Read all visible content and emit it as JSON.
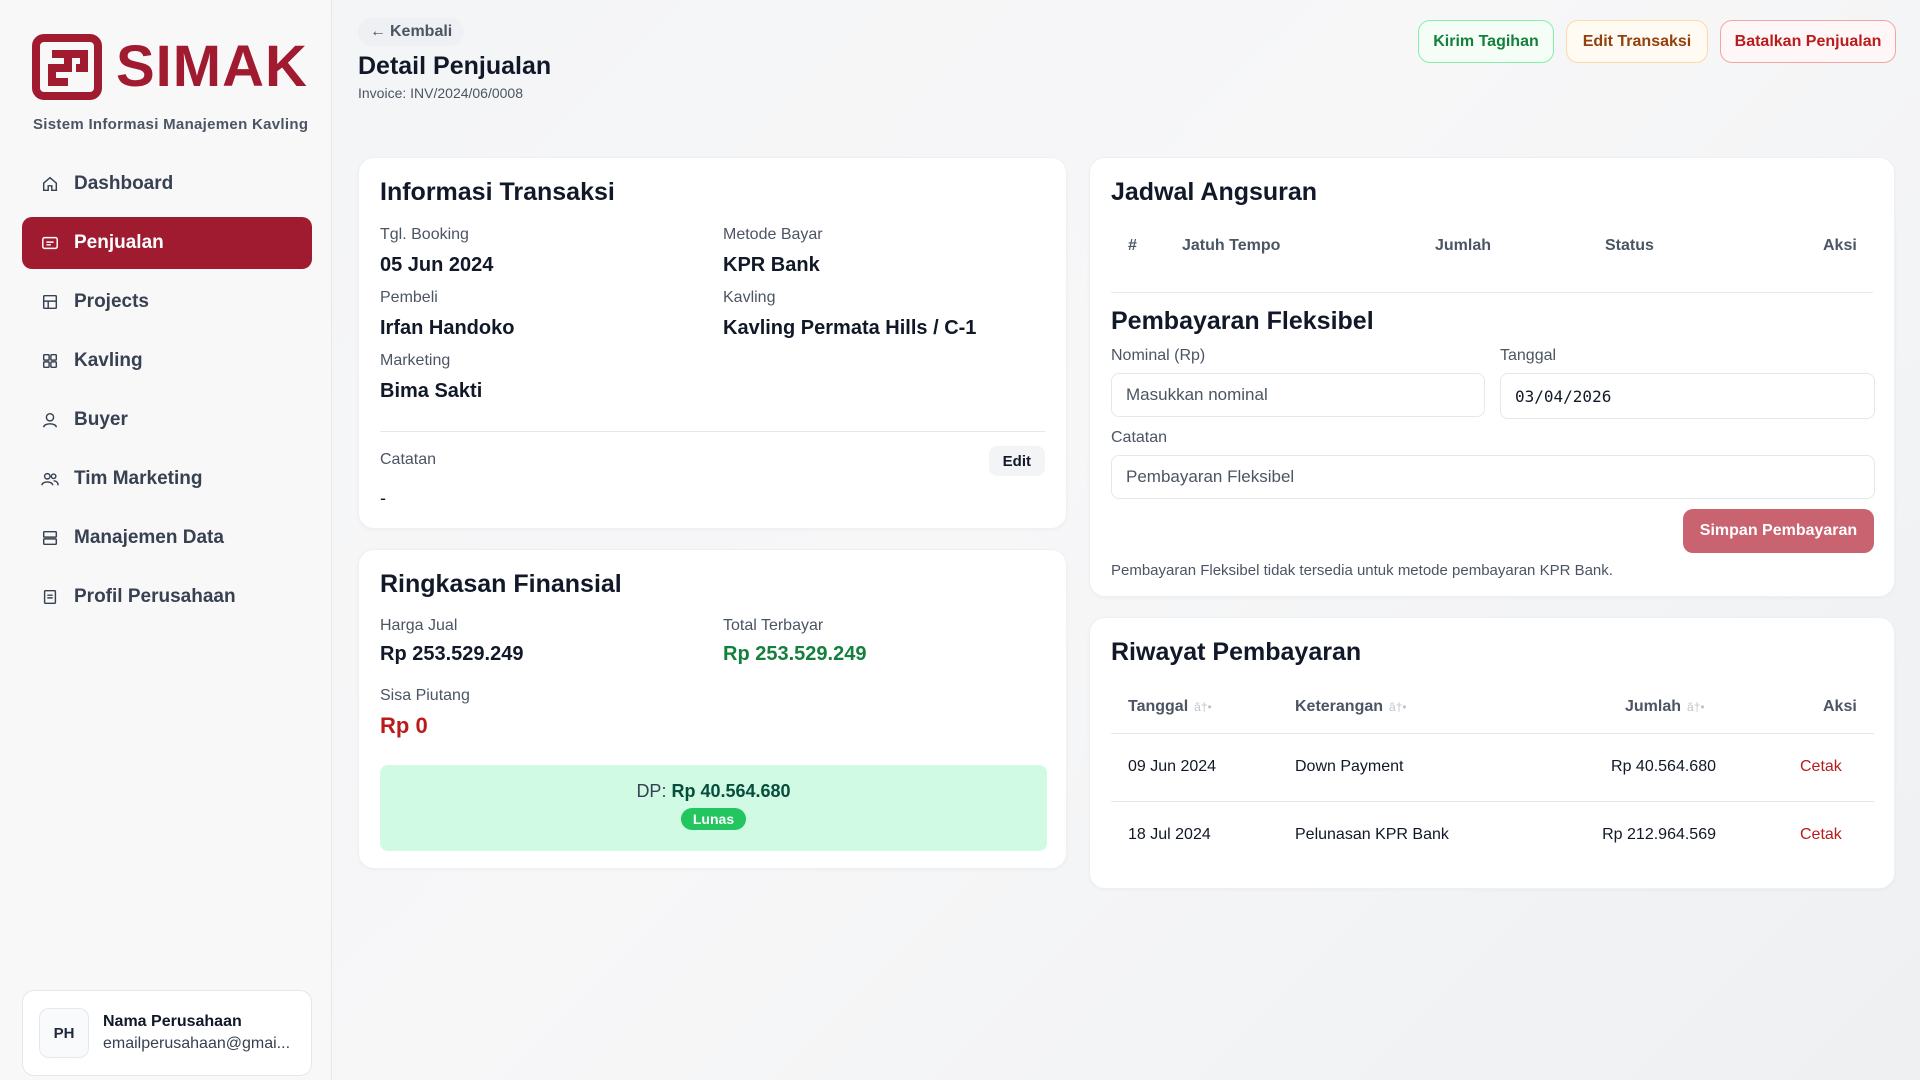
{
  "brand": {
    "name": "SIMAK",
    "subtitle": "Sistem Informasi Manajemen Kavling",
    "color": "#a01b30"
  },
  "sidebar": {
    "items": [
      {
        "label": "Dashboard",
        "icon": "home-icon"
      },
      {
        "label": "Penjualan",
        "icon": "receipt-icon",
        "active": true
      },
      {
        "label": "Projects",
        "icon": "building-icon"
      },
      {
        "label": "Kavling",
        "icon": "grid-icon"
      },
      {
        "label": "Buyer",
        "icon": "user-icon"
      },
      {
        "label": "Tim Marketing",
        "icon": "users-icon"
      },
      {
        "label": "Manajemen Data",
        "icon": "database-icon"
      },
      {
        "label": "Profil Perusahaan",
        "icon": "document-icon"
      }
    ]
  },
  "company": {
    "name": "Nama Perusahaan",
    "email": "emailperusahaan@gmai...",
    "logo_text": "PH"
  },
  "header": {
    "back_label": "Kembali",
    "title": "Detail Penjualan",
    "invoice": "Invoice: INV/2024/06/0008",
    "buttons": {
      "send_invoice": "Kirim Tagihan",
      "edit_transaction": "Edit Transaksi",
      "cancel_sale": "Batalkan Penjualan"
    }
  },
  "transaction": {
    "title": "Informasi Transaksi",
    "booking_label": "Tgl. Booking",
    "booking_value": "05 Jun 2024",
    "payment_method_label": "Metode Bayar",
    "payment_method_value": "KPR Bank",
    "buyer_label": "Pembeli",
    "buyer_value": "Irfan Handoko",
    "plot_label": "Kavling",
    "plot_value": "Kavling Permata Hills / C-1",
    "marketing_label": "Marketing",
    "marketing_value": "Bima Sakti",
    "notes_label": "Catatan",
    "notes_value": "-",
    "edit_label": "Edit"
  },
  "financial": {
    "title": "Ringkasan Finansial",
    "price_label": "Harga Jual",
    "price_value": "Rp 253.529.249",
    "paid_label": "Total Terbayar",
    "paid_value": "Rp 253.529.249",
    "remaining_label": "Sisa Piutang",
    "remaining_value": "Rp 0",
    "dp_label": "DP:",
    "dp_value": "Rp 40.564.680",
    "status_badge": "Lunas"
  },
  "schedule": {
    "title": "Jadwal Angsuran",
    "columns": [
      "#",
      "Jatuh Tempo",
      "Jumlah",
      "Status",
      "Aksi"
    ]
  },
  "flexible_payment": {
    "title": "Pembayaran Fleksibel",
    "nominal_label": "Nominal (Rp)",
    "nominal_placeholder": "Masukkan nominal",
    "date_label": "Tanggal",
    "date_value": "03/04/2026",
    "notes_label": "Catatan",
    "notes_value": "Pembayaran Fleksibel",
    "save_button": "Simpan Pembayaran",
    "info_note": "Pembayaran Fleksibel tidak tersedia untuk metode pembayaran KPR Bank."
  },
  "history": {
    "title": "Riwayat Pembayaran",
    "sort_glyph": "â†•",
    "columns": {
      "date": "Tanggal",
      "description": "Keterangan",
      "amount": "Jumlah",
      "action": "Aksi"
    },
    "rows": [
      {
        "date": "09 Jun 2024",
        "description": "Down Payment",
        "amount": "Rp 40.564.680",
        "action": "Cetak"
      },
      {
        "date": "18 Jul 2024",
        "description": "Pelunasan KPR Bank",
        "amount": "Rp 212.964.569",
        "action": "Cetak"
      }
    ]
  }
}
